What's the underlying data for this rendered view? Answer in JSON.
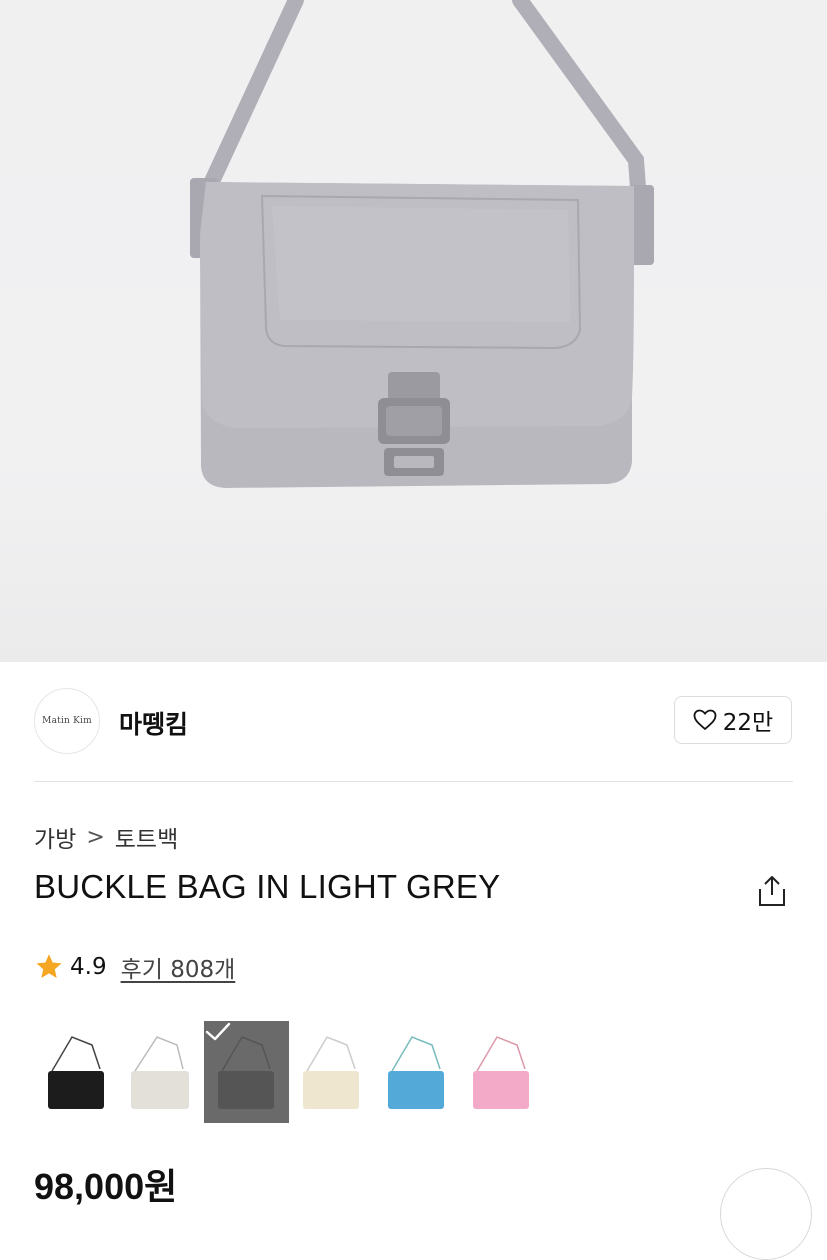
{
  "brand": {
    "name": "마뗑킴",
    "logo_text": "Matin Kim"
  },
  "like": {
    "count": "22만"
  },
  "breadcrumb": {
    "level1": "가방",
    "separator": ">",
    "level2": "토트백"
  },
  "product": {
    "title": "BUCKLE BAG IN LIGHT GREY",
    "price": "98,000원"
  },
  "rating": {
    "score": "4.9",
    "reviews": "후기 808개"
  },
  "swatches": [
    {
      "color": "#1c1c1c",
      "selected": false
    },
    {
      "color": "#e3e0d9",
      "selected": false
    },
    {
      "color": "#7c7c7c",
      "selected": true
    },
    {
      "color": "#efe6cf",
      "selected": false
    },
    {
      "color": "#53aad8",
      "selected": false
    },
    {
      "color": "#f3a9c8",
      "selected": false
    }
  ],
  "icons": {
    "like": "heart-icon",
    "share": "share-icon",
    "star": "star-icon",
    "check": "check-icon"
  },
  "colors": {
    "star": "#f5a623",
    "product_bag": "#b7b5bc"
  }
}
